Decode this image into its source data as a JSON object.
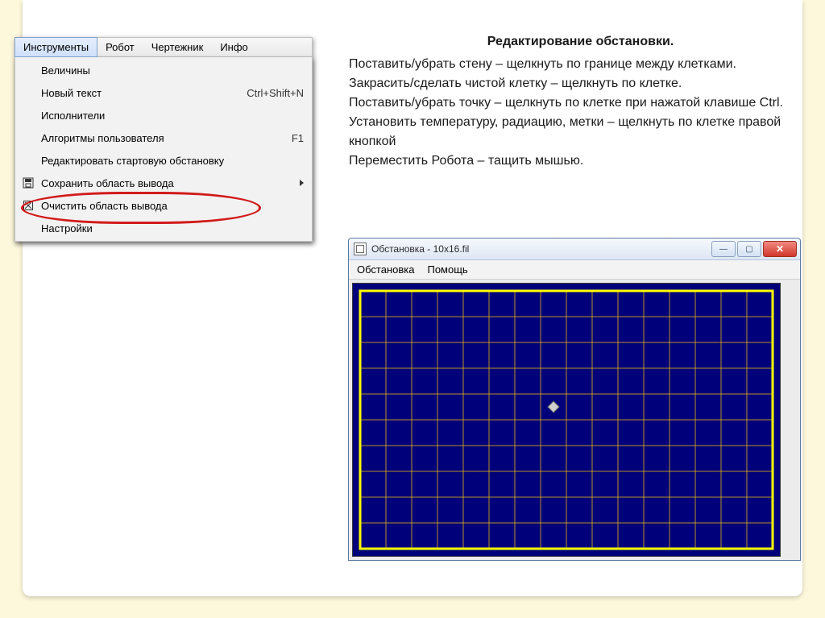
{
  "menubar": {
    "items": [
      "Инструменты",
      "Робот",
      "Чертежник",
      "Инфо"
    ],
    "active_index": 0
  },
  "dropdown": {
    "items": [
      {
        "label": "Величины",
        "shortcut": "",
        "icon": "",
        "submenu": false
      },
      {
        "label": "Новый текст",
        "shortcut": "Ctrl+Shift+N",
        "icon": "",
        "submenu": false
      },
      {
        "label": "Исполнители",
        "shortcut": "",
        "icon": "",
        "submenu": false
      },
      {
        "label": "Алгоритмы пользователя",
        "shortcut": "F1",
        "icon": "",
        "submenu": false
      },
      {
        "label": "Редактировать стартовую обстановку",
        "shortcut": "",
        "icon": "",
        "submenu": false,
        "highlighted": true
      },
      {
        "label": "Сохранить область вывода",
        "shortcut": "",
        "icon": "save",
        "submenu": true
      },
      {
        "label": "Очистить область вывода",
        "shortcut": "",
        "icon": "clear",
        "submenu": false
      },
      {
        "label": "Настройки",
        "shortcut": "",
        "icon": "",
        "submenu": false
      }
    ]
  },
  "instructions": {
    "title": "Редактирование обстановки.",
    "lines": [
      "Поставить/убрать стену – щелкнуть по границе между клетками.",
      "Закрасить/сделать чистой клетку – щелкнуть по клетке.",
      "Поставить/убрать точку – щелкнуть по клетке при нажатой клавише Ctrl.",
      "Установить температуру, радиацию, метки – щелкнуть по клетке правой кнопкой",
      "Переместить Робота – тащить мышью."
    ]
  },
  "env_window": {
    "title": "Обстановка - 10x16.fil",
    "menu": [
      "Обстановка",
      "Помощь"
    ],
    "grid": {
      "rows": 10,
      "cols": 16,
      "cell": 32
    },
    "robot": {
      "row": 4,
      "col": 7
    },
    "colors": {
      "bg": "#00007a",
      "grid_line": "#ffcc00",
      "border": "#ffff00",
      "robot": "#d0d0d0"
    }
  }
}
